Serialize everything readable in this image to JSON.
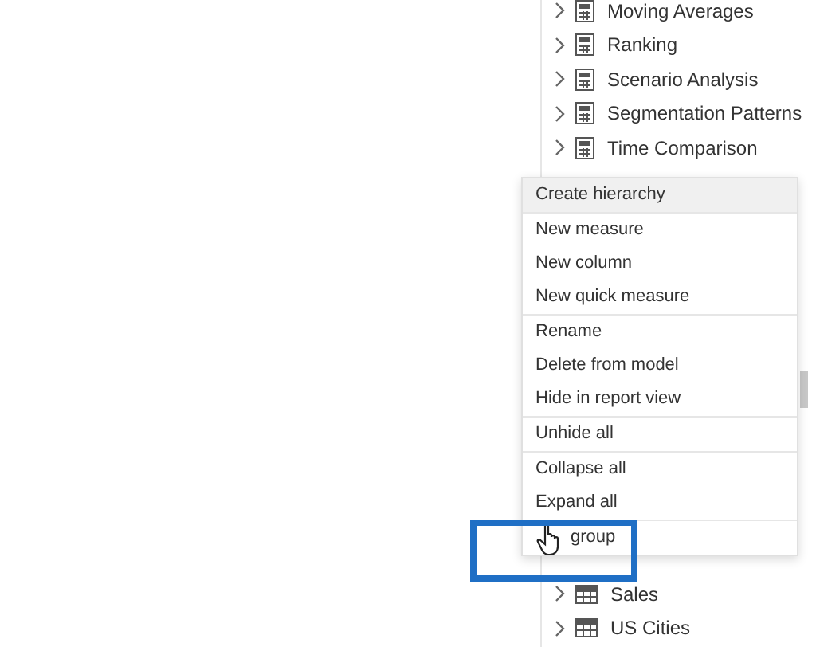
{
  "fields_tree": {
    "top_items": [
      {
        "label": "Moving Averages",
        "kind": "measures"
      },
      {
        "label": "Ranking",
        "kind": "measures"
      },
      {
        "label": "Scenario Analysis",
        "kind": "measures"
      },
      {
        "label": "Segmentation Patterns",
        "kind": "measures"
      },
      {
        "label": "Time Comparison",
        "kind": "measures"
      }
    ],
    "bottom_items": [
      {
        "label": "Sales",
        "kind": "table"
      },
      {
        "label": "US Cities",
        "kind": "table"
      }
    ]
  },
  "context_menu": {
    "groups": [
      [
        {
          "label": "Create hierarchy",
          "highlighted": true
        }
      ],
      [
        {
          "label": "New measure",
          "highlighted": false
        },
        {
          "label": "New column",
          "highlighted": false
        },
        {
          "label": "New quick measure",
          "highlighted": false
        }
      ],
      [
        {
          "label": "Rename",
          "highlighted": false
        },
        {
          "label": "Delete from model",
          "highlighted": false
        },
        {
          "label": "Hide in report view",
          "highlighted": false
        }
      ],
      [
        {
          "label": "Unhide all",
          "highlighted": false
        }
      ],
      [
        {
          "label": "Collapse all",
          "highlighted": false
        },
        {
          "label": "Expand all",
          "highlighted": false
        }
      ],
      [
        {
          "label": "group",
          "highlighted": false,
          "pointer": true
        }
      ]
    ]
  }
}
